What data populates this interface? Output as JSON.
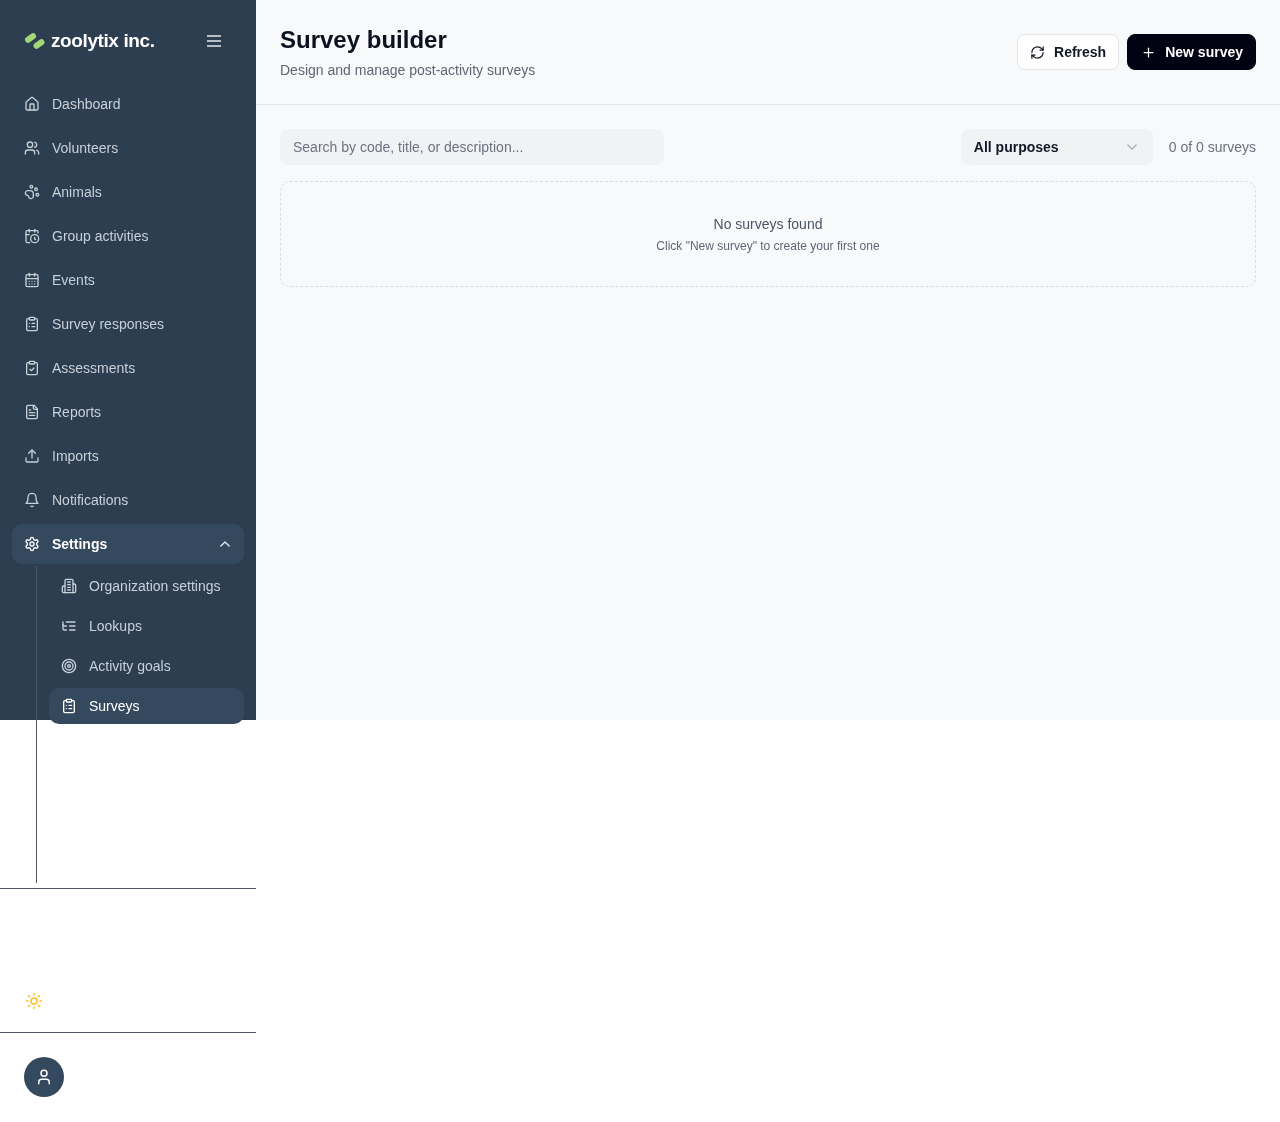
{
  "brand": {
    "name": "zoolytix inc."
  },
  "sidebar": {
    "items": [
      {
        "label": "Dashboard",
        "selected": false
      },
      {
        "label": "Volunteers",
        "selected": false
      },
      {
        "label": "Animals",
        "selected": false
      },
      {
        "label": "Group activities",
        "selected": false
      },
      {
        "label": "Events",
        "selected": false
      },
      {
        "label": "Survey responses",
        "selected": false
      },
      {
        "label": "Assessments",
        "selected": false
      },
      {
        "label": "Reports",
        "selected": false
      },
      {
        "label": "Imports",
        "selected": false
      },
      {
        "label": "Notifications",
        "selected": false
      },
      {
        "label": "Settings",
        "selected": true,
        "expanded": true,
        "children": [
          {
            "label": "Organization settings",
            "selected": false
          },
          {
            "label": "Lookups",
            "selected": false
          },
          {
            "label": "Activity goals",
            "selected": false
          },
          {
            "label": "Surveys",
            "selected": true
          }
        ]
      }
    ]
  },
  "header": {
    "title": "Survey builder",
    "subtitle": "Design and manage post-activity surveys",
    "buttons": [
      {
        "label": "Refresh",
        "kind": "secondary"
      },
      {
        "label": "New survey",
        "kind": "primary"
      }
    ]
  },
  "filters": {
    "search": {
      "placeholder": "Search by code, title, or description..."
    },
    "purpose": {
      "value": "All purposes"
    },
    "count": "0 of 0 surveys"
  },
  "empty_state": {
    "title": "No surveys found",
    "hint": "Click \"New survey\" to create your first one"
  }
}
